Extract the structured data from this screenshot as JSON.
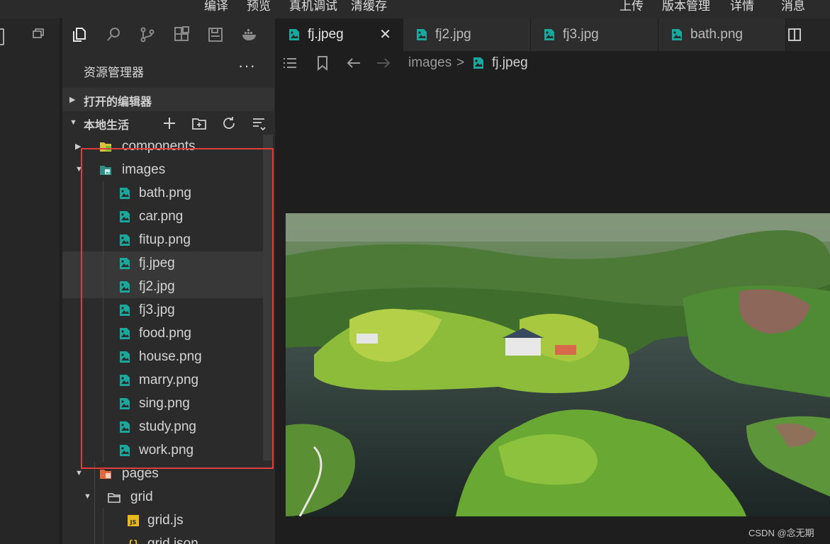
{
  "top_menu": {
    "compile": "编译",
    "preview": "预览",
    "device_debug": "真机调试",
    "clear_cache": "清缓存",
    "upload": "上传",
    "version": "版本管理",
    "details": "详情",
    "messages": "消息"
  },
  "sidebar": {
    "title": "资源管理器",
    "more": "···",
    "open_editors": "打开的编辑器",
    "project": "本地生活"
  },
  "tree": [
    {
      "name": "components",
      "kind": "folder",
      "depth": 0,
      "expanded": false
    },
    {
      "name": "images",
      "kind": "folder-images",
      "depth": 0,
      "expanded": true
    },
    {
      "name": "bath.png",
      "kind": "image",
      "depth": 1
    },
    {
      "name": "car.png",
      "kind": "image",
      "depth": 1
    },
    {
      "name": "fitup.png",
      "kind": "image",
      "depth": 1
    },
    {
      "name": "fj.jpeg",
      "kind": "image",
      "depth": 1,
      "selected": true
    },
    {
      "name": "fj2.jpg",
      "kind": "image",
      "depth": 1,
      "selected": true
    },
    {
      "name": "fj3.jpg",
      "kind": "image",
      "depth": 1
    },
    {
      "name": "food.png",
      "kind": "image",
      "depth": 1
    },
    {
      "name": "house.png",
      "kind": "image",
      "depth": 1
    },
    {
      "name": "marry.png",
      "kind": "image",
      "depth": 1
    },
    {
      "name": "sing.png",
      "kind": "image",
      "depth": 1
    },
    {
      "name": "study.png",
      "kind": "image",
      "depth": 1
    },
    {
      "name": "work.png",
      "kind": "image",
      "depth": 1
    },
    {
      "name": "pages",
      "kind": "folder-pages",
      "depth": 0,
      "expanded": true
    },
    {
      "name": "grid",
      "kind": "folder-plain",
      "depth": 1,
      "expanded": true
    },
    {
      "name": "grid.js",
      "kind": "js",
      "depth": 2
    },
    {
      "name": "grid.json",
      "kind": "json",
      "depth": 2
    }
  ],
  "tabs": [
    {
      "label": "fj.jpeg",
      "active": true
    },
    {
      "label": "fj2.jpg",
      "active": false
    },
    {
      "label": "fj3.jpg",
      "active": false
    },
    {
      "label": "bath.png",
      "active": false
    }
  ],
  "tab_close": "✕",
  "breadcrumb": {
    "folder": "images",
    "separator": ">",
    "file": "fj.jpeg"
  },
  "watermark": "CSDN @念无期",
  "colors": {
    "image_icon": "#1aa89c",
    "highlight_box": "#e03c3c",
    "components_folder": "#d8c23a",
    "pages_folder": "#e06a3c",
    "js_icon": "#e8b820"
  }
}
